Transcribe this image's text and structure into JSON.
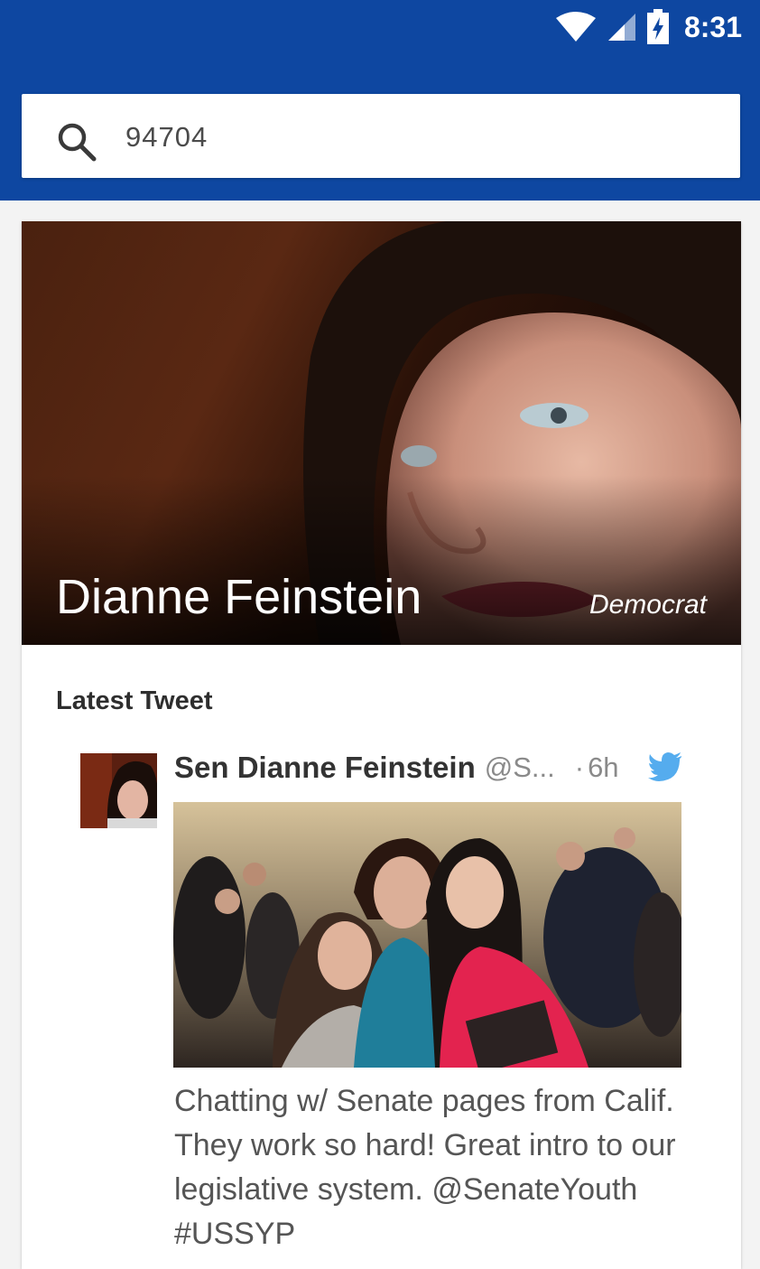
{
  "status_bar": {
    "time": "8:31",
    "icons": [
      "wifi-icon",
      "cell-signal-icon",
      "battery-charging-icon"
    ]
  },
  "search": {
    "value": "94704",
    "icon": "search-icon"
  },
  "representative": {
    "name": "Dianne Feinstein",
    "party": "Democrat"
  },
  "latest_tweet": {
    "section_title": "Latest Tweet",
    "author": "Sen Dianne Feinstein",
    "handle": "@S...",
    "dot": "·",
    "age": "6h",
    "icon": "twitter-bird-icon",
    "text": "Chatting w/ Senate pages from Calif. They work so hard! Great intro to our legislative system. @SenateYouth #USSYP"
  },
  "colors": {
    "app_bar": "#0e47a1",
    "background": "#f3f3f3",
    "twitter_blue": "#55acee"
  }
}
